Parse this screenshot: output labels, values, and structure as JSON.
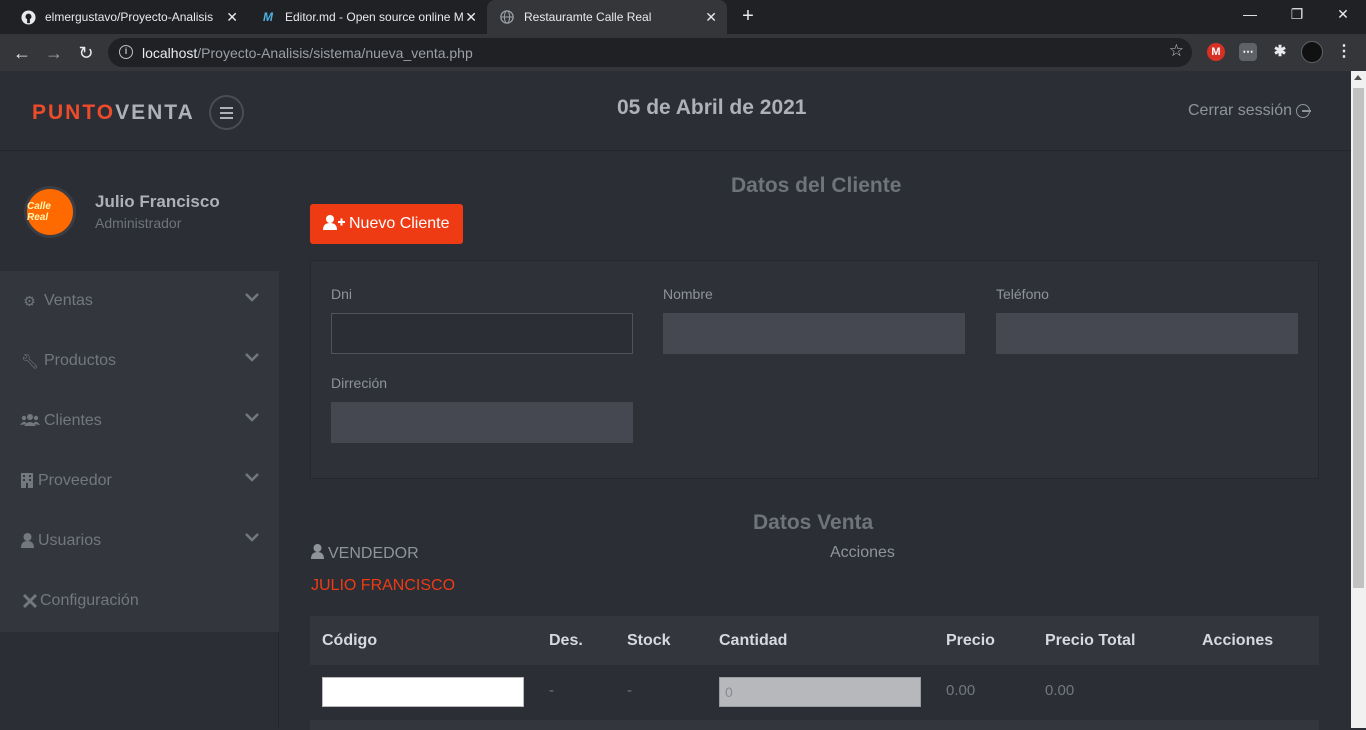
{
  "browser": {
    "tabs": [
      {
        "title": "elmergustavo/Proyecto-Analisis",
        "icon": "github-icon"
      },
      {
        "title": "Editor.md - Open source online M",
        "icon": "editor-md-icon"
      },
      {
        "title": "Restauramte Calle Real",
        "icon": "globe-icon"
      }
    ],
    "url_host": "localhost",
    "url_path": "/Proyecto-Analisis/sistema/nueva_venta.php"
  },
  "header": {
    "logo_part1": "PUNTO",
    "logo_part2": "VENTA",
    "date": "05 de Abril de 2021",
    "logout": "Cerrar sessión"
  },
  "profile": {
    "name": "Julio Francisco",
    "role": "Administrador",
    "avatar_text": "Calle Real"
  },
  "sidebar": {
    "items": [
      {
        "label": "Ventas",
        "icon": "gear-icon"
      },
      {
        "label": "Productos",
        "icon": "wrench-icon"
      },
      {
        "label": "Clientes",
        "icon": "users-icon"
      },
      {
        "label": "Proveedor",
        "icon": "building-icon"
      },
      {
        "label": "Usuarios",
        "icon": "user-icon"
      },
      {
        "label": "Configuración",
        "icon": "tools-icon"
      }
    ]
  },
  "client": {
    "title": "Datos del Cliente",
    "new_button": "Nuevo Cliente",
    "dni_label": "Dni",
    "dni_value": "",
    "nombre_label": "Nombre",
    "telefono_label": "Teléfono",
    "direccion_label": "Dirreción"
  },
  "sale": {
    "title": "Datos Venta",
    "vendedor_label": "VENDEDOR",
    "acciones_label": "Acciones",
    "vendedor_name": "JULIO FRANCISCO"
  },
  "table": {
    "headers": [
      "Código",
      "Des.",
      "Stock",
      "Cantidad",
      "Precio",
      "Precio Total",
      "Acciones"
    ],
    "row": {
      "des": "-",
      "stock": "-",
      "cantidad": "0",
      "precio": "0.00",
      "precio_total": "0.00"
    }
  },
  "colors": {
    "accent": "#ee3b14",
    "background": "#2b2e35",
    "sidebar_menu": "#33363d"
  }
}
